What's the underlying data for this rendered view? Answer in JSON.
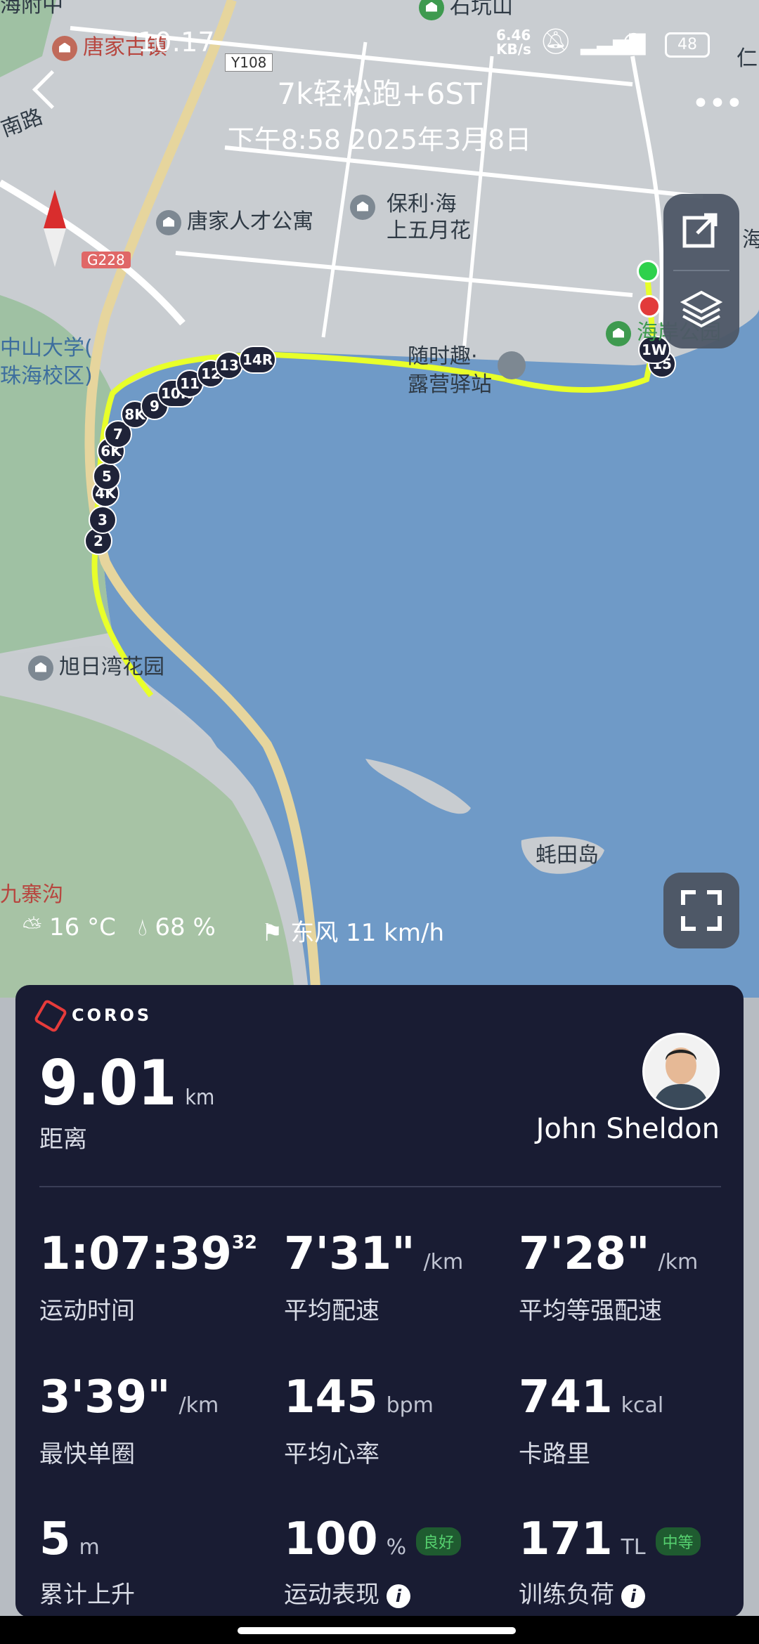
{
  "status_bar": {
    "time": "10:17",
    "net_rate_value": "6.46",
    "net_rate_unit": "KB/s",
    "battery": "48"
  },
  "header": {
    "title": "7k轻松跑+6ST",
    "datetime": "下午8:58 2025年3月8日"
  },
  "map": {
    "labels": {
      "north_top": "海附中",
      "shikengshan": "石坑山",
      "tangjiayu": "唐家古镇",
      "road_y108": "Y108",
      "road_left": "南路",
      "tangjia_apartment": "唐家人才公寓",
      "poly_line1": "保利·海",
      "poly_line2": "上五月花",
      "road_g228": "G228",
      "sysu_line1": "中山大学(",
      "sysu_line2": "珠海校区)",
      "station_line1": "随时趣·",
      "station_line2": "露营驿站",
      "park": "海岸公园",
      "right_edge": "仁",
      "right_edge2": "海",
      "xuri": "旭日湾花园",
      "island": "蚝田岛",
      "jiuzhaigou": "九寨沟"
    },
    "lap_markers": [
      "2",
      "3",
      "4K",
      "5",
      "6K",
      "7",
      "8K",
      "9",
      "10K",
      "11",
      "12",
      "13",
      "14R",
      "15",
      "1W"
    ],
    "route_color": "#e8ff2a"
  },
  "weather": {
    "temperature": "16 °C",
    "humidity": "68 %",
    "wind": "东风 11 km/h"
  },
  "card": {
    "brand": "COROS",
    "distance": {
      "value": "9.01",
      "unit": "km",
      "label": "距离"
    },
    "user_name": "John Sheldon",
    "metrics": [
      {
        "value": "1:07:39",
        "sup": "32",
        "unit": "",
        "label": "运动时间"
      },
      {
        "value": "7'31\"",
        "unit": "/km",
        "label": "平均配速"
      },
      {
        "value": "7'28\"",
        "unit": "/km",
        "label": "平均等强配速"
      },
      {
        "value": "3'39\"",
        "unit": "/km",
        "label": "最快单圈"
      },
      {
        "value": "145",
        "unit": "bpm",
        "label": "平均心率"
      },
      {
        "value": "741",
        "unit": "kcal",
        "label": "卡路里"
      },
      {
        "value": "5",
        "unit": "m",
        "label": "累计上升"
      },
      {
        "value": "100",
        "unit": "%",
        "badge": "良好",
        "label": "运动表现"
      },
      {
        "value": "171",
        "unit": "TL",
        "badge": "中等",
        "label": "训练负荷"
      }
    ],
    "colors": {
      "background": "#191c33",
      "badge_good": "#2f8a3e",
      "badge_mid": "#2f8a3e",
      "brand_red": "#e63b3b"
    }
  }
}
